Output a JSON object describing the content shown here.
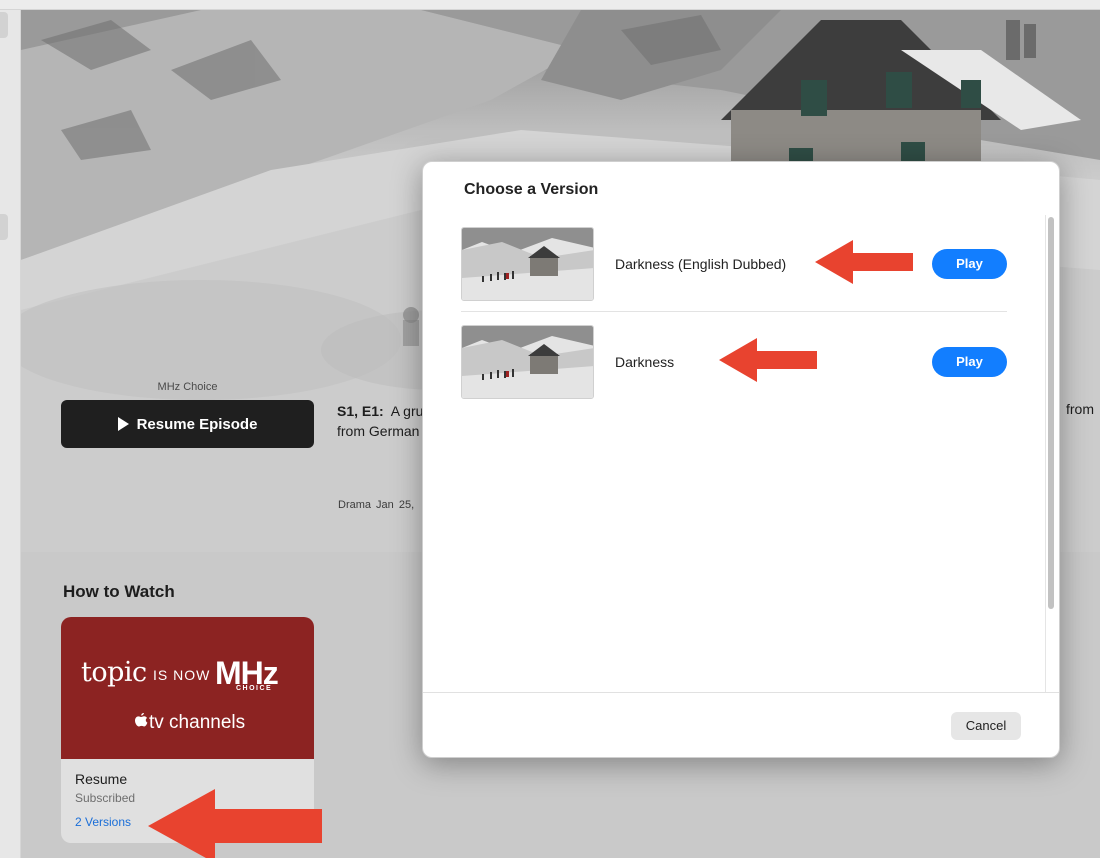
{
  "hero": {
    "provider": "MHz Choice",
    "resume_label": "Resume Episode",
    "episode_label": "S1, E1:",
    "episode_text": "A gru",
    "episode_right": "from",
    "episode_line2": "from German",
    "meta": "Drama   Jan 25,"
  },
  "how_to_watch": {
    "title": "How to Watch",
    "card": {
      "logo_topic": "topic",
      "logo_isnow": "IS NOW",
      "logo_mhz": "MHz",
      "logo_choice": "CHOICE",
      "logo_channels": "tv channels",
      "status": "Resume",
      "subscription": "Subscribed",
      "versions_link": "2 Versions"
    }
  },
  "dialog": {
    "title": "Choose a Version",
    "versions": [
      {
        "name": "Darkness (English Dubbed)",
        "play_label": "Play"
      },
      {
        "name": "Darkness",
        "play_label": "Play"
      }
    ],
    "cancel_label": "Cancel"
  },
  "colors": {
    "accent_blue": "#127eff",
    "link_blue": "#1a6ed8",
    "arrow_red": "#e8432f",
    "channel_red": "#8c2322"
  }
}
